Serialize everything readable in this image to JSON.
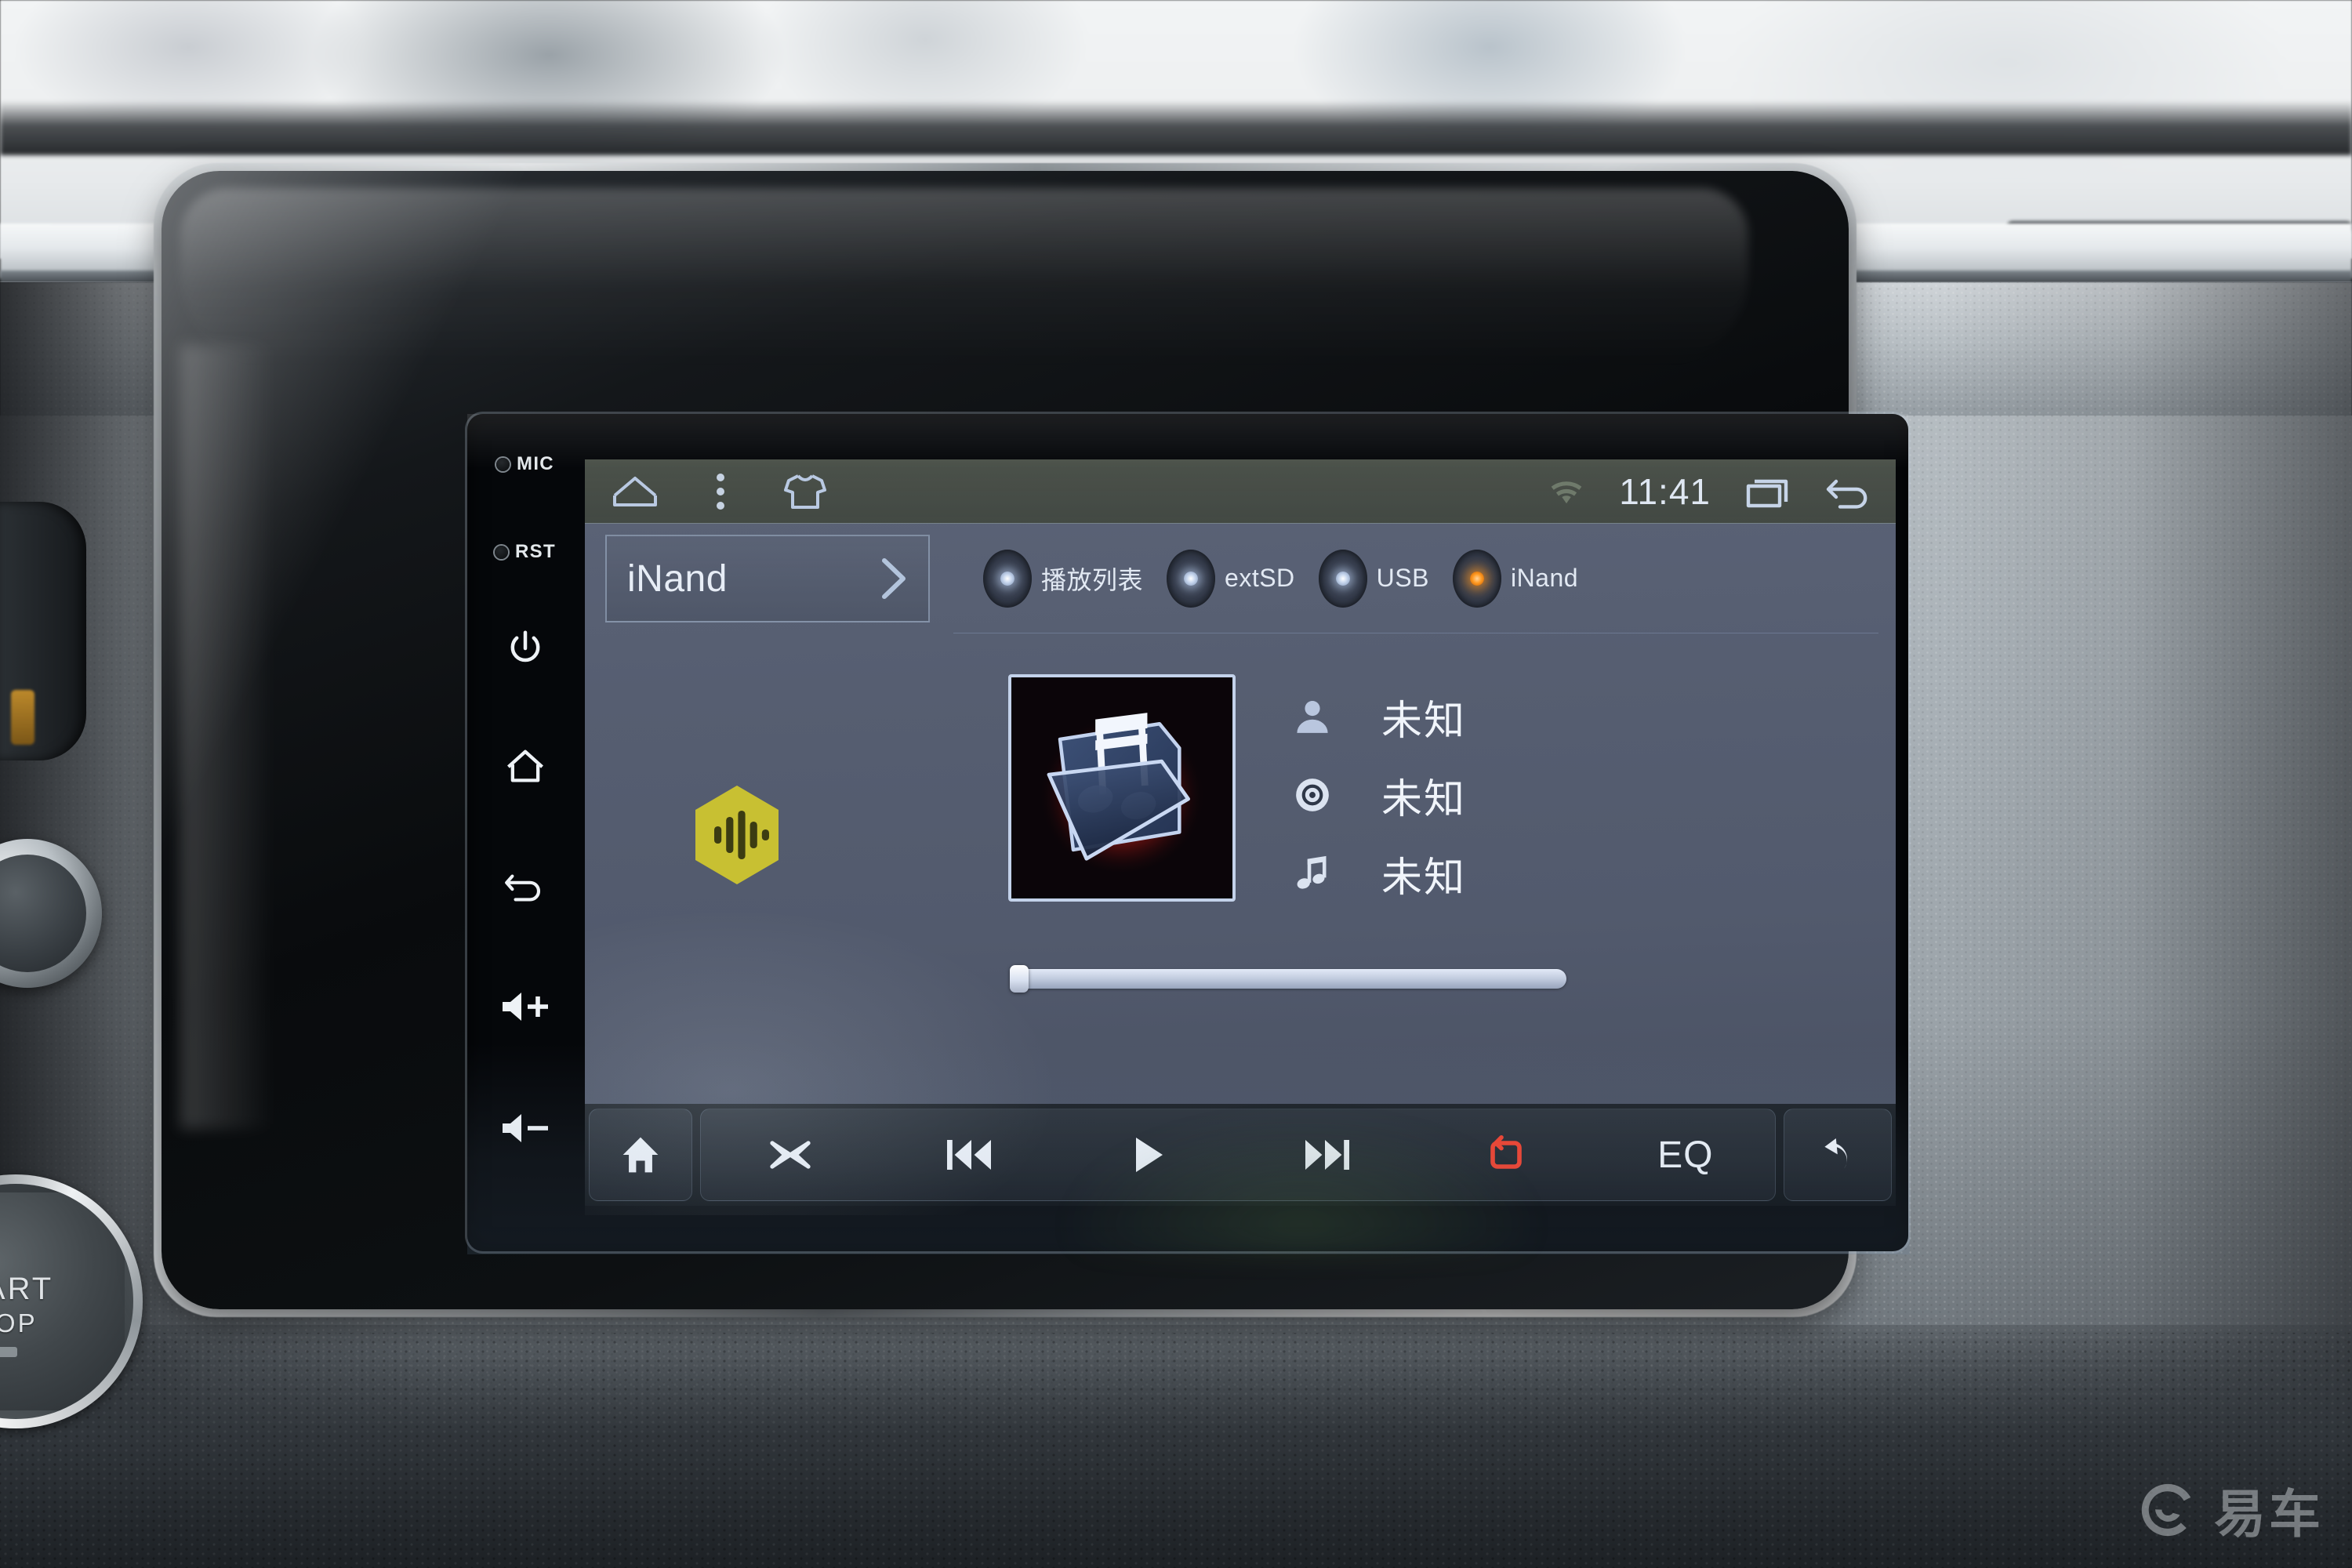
{
  "device": {
    "hardkeys": [
      {
        "type": "led",
        "label": "MIC",
        "name": "mic-led"
      },
      {
        "type": "led",
        "label": "RST",
        "name": "reset-led"
      },
      {
        "type": "icon",
        "icon": "power-icon",
        "name": "power-button"
      },
      {
        "type": "icon",
        "icon": "home-icon",
        "name": "home-button"
      },
      {
        "type": "icon",
        "icon": "back-icon",
        "name": "back-button"
      },
      {
        "type": "icon",
        "icon": "volume-up-icon",
        "name": "volume-up-button"
      },
      {
        "type": "icon",
        "icon": "volume-down-icon",
        "name": "volume-down-button"
      }
    ],
    "start_button": {
      "line1": "START",
      "line2": "STOP"
    }
  },
  "statusbar": {
    "home_icon": "home-icon",
    "menu_icon": "overflow-menu-icon",
    "theme_icon": "tshirt-theme-icon",
    "wifi_icon": "wifi-icon",
    "clock": "11:41",
    "recents_icon": "recents-icon",
    "back_icon": "back-arrow-icon"
  },
  "source": {
    "current": "iNand",
    "chevron": "chevron-right-icon",
    "tabs": [
      {
        "label": "播放列表",
        "active": false
      },
      {
        "label": "extSD",
        "active": false
      },
      {
        "label": "USB",
        "active": false
      },
      {
        "label": "iNand",
        "active": true
      }
    ]
  },
  "nowplaying": {
    "album_art_alt": "music-folder-artwork",
    "eq_badge": "equalizer-badge",
    "artist_label": "未知",
    "album_label": "未知",
    "title_label": "未知",
    "progress_percent": 0
  },
  "transport": {
    "home": {
      "icon": "home-icon",
      "label": ""
    },
    "shuffle": {
      "icon": "shuffle-icon",
      "label": ""
    },
    "previous": {
      "icon": "previous-track-icon",
      "label": ""
    },
    "play": {
      "icon": "play-icon",
      "label": ""
    },
    "next": {
      "icon": "next-track-icon",
      "label": ""
    },
    "repeat": {
      "icon": "repeat-icon",
      "label": "",
      "active": true,
      "color": "#f2402c"
    },
    "eq": {
      "icon": "eq-text",
      "label": "EQ"
    },
    "back": {
      "icon": "back-curved-arrow-icon",
      "label": ""
    }
  },
  "watermark": {
    "text": "易车",
    "logo": "yiche-logo-icon"
  },
  "colors": {
    "screen_bg": "#555d70",
    "statusbar_bg": "#4a5046",
    "accent_active": "#ff9a22",
    "repeat_active": "#f2402c",
    "text_primary": "#eef3fa",
    "eq_badge": "#c8c032"
  }
}
